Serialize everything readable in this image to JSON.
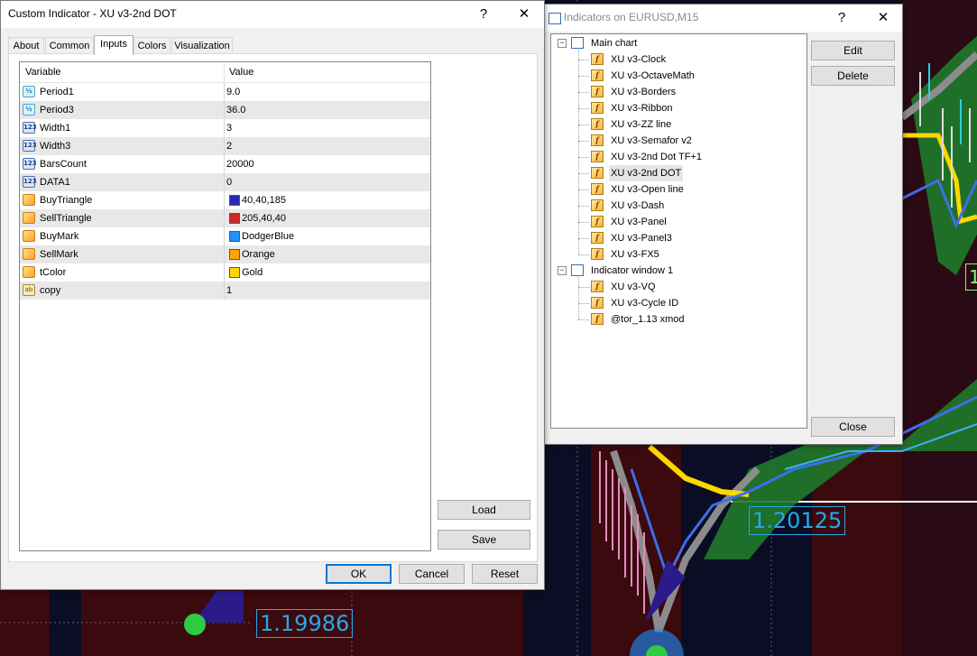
{
  "dialog": {
    "title": "Custom Indicator - XU v3-2nd DOT",
    "help_glyph": "?",
    "close_glyph": "✕",
    "tabs": [
      {
        "label": "About"
      },
      {
        "label": "Common"
      },
      {
        "label": "Inputs"
      },
      {
        "label": "Colors"
      },
      {
        "label": "Visualization"
      }
    ],
    "active_tab": "Inputs",
    "grid": {
      "col_variable": "Variable",
      "col_value": "Value",
      "rows": [
        {
          "type": "double",
          "icon_text": "½",
          "name": "Period1",
          "value": "9.0"
        },
        {
          "type": "double",
          "icon_text": "½",
          "name": "Period3",
          "value": "36.0"
        },
        {
          "type": "int",
          "icon_text": "123",
          "name": "Width1",
          "value": "3"
        },
        {
          "type": "int",
          "icon_text": "123",
          "name": "Width3",
          "value": "2"
        },
        {
          "type": "int",
          "icon_text": "123",
          "name": "BarsCount",
          "value": "20000"
        },
        {
          "type": "int",
          "icon_text": "123",
          "name": "DATA1",
          "value": "0"
        },
        {
          "type": "color",
          "icon_text": "",
          "name": "BuyTriangle",
          "value": "40,40,185",
          "swatch": "#2828b9"
        },
        {
          "type": "color",
          "icon_text": "",
          "name": "SellTriangle",
          "value": "205,40,40",
          "swatch": "#cd2828"
        },
        {
          "type": "color",
          "icon_text": "",
          "name": "BuyMark",
          "value": "DodgerBlue",
          "swatch": "#1e90ff"
        },
        {
          "type": "color",
          "icon_text": "",
          "name": "SellMark",
          "value": "Orange",
          "swatch": "#ffa500"
        },
        {
          "type": "color",
          "icon_text": "",
          "name": "tColor",
          "value": "Gold",
          "swatch": "#ffd700"
        },
        {
          "type": "string",
          "icon_text": "ab",
          "name": "copy",
          "value": "1"
        }
      ]
    },
    "buttons": {
      "load": "Load",
      "save": "Save",
      "ok": "OK",
      "cancel": "Cancel",
      "reset": "Reset"
    }
  },
  "indicators_window": {
    "title": "Indicators on EURUSD,M15",
    "help_glyph": "?",
    "close_glyph": "✕",
    "buttons": {
      "edit": "Edit",
      "delete": "Delete",
      "close": "Close"
    },
    "tree": {
      "main_chart": {
        "label": "Main chart",
        "items": [
          "XU v3-Clock",
          "XU v3-OctaveMath",
          "XU v3-Borders",
          "XU v3-Ribbon",
          "XU v3-ZZ line",
          "XU v3-Semafor v2",
          "XU v3-2nd Dot TF+1",
          "XU v3-2nd DOT",
          "XU v3-Open line",
          "XU v3-Dash",
          "XU v3-Panel",
          "XU v3-Panel3",
          "XU v3-FX5"
        ],
        "selected": "XU v3-2nd DOT"
      },
      "indicator_window": {
        "label": "Indicator window 1",
        "items": [
          "XU v3-VQ",
          "XU v3-Cycle ID",
          "@tor_1.13 xmod"
        ]
      }
    }
  },
  "chart": {
    "price_labels": {
      "right": "1.20125",
      "bottom": "1.19986",
      "edge": "1"
    },
    "colors": {
      "background": "#0b0d24",
      "maroon": "#3a0a0f",
      "price_text": "#2aa8e8",
      "gold_line": "#ffd700",
      "blue_line": "#3f6ee8",
      "green_band": "#1f7a2a",
      "gray_line": "#8c8c8c"
    }
  }
}
